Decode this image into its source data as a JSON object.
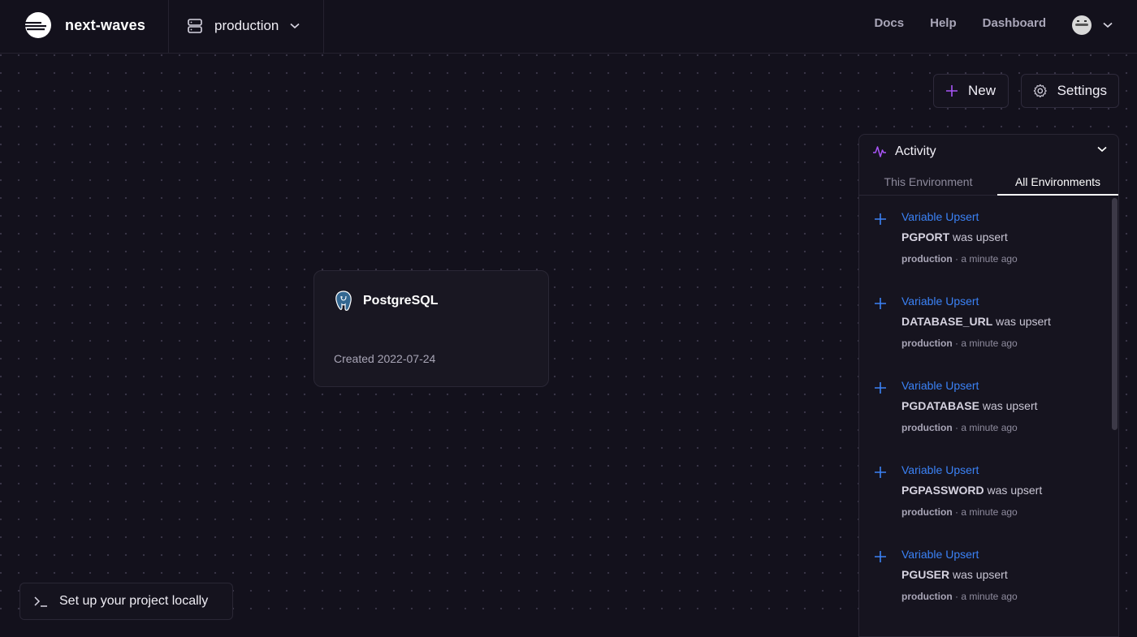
{
  "app": {
    "project_name": "next-waves",
    "environment": "production"
  },
  "nav": {
    "docs": "Docs",
    "help": "Help",
    "dashboard": "Dashboard"
  },
  "toolbar": {
    "new_label": "New",
    "settings_label": "Settings"
  },
  "service": {
    "name": "PostgreSQL",
    "created": "Created 2022-07-24",
    "icon": "postgresql-icon"
  },
  "setup": {
    "label": "Set up your project locally"
  },
  "activity": {
    "title": "Activity",
    "tabs": [
      "This Environment",
      "All Environments"
    ],
    "active_tab": "All Environments",
    "items": [
      {
        "title": "Variable Upsert",
        "variable": "PGPORT",
        "action": "was upsert",
        "env": "production",
        "time": "· a minute ago"
      },
      {
        "title": "Variable Upsert",
        "variable": "DATABASE_URL",
        "action": "was upsert",
        "env": "production",
        "time": "· a minute ago"
      },
      {
        "title": "Variable Upsert",
        "variable": "PGDATABASE",
        "action": "was upsert",
        "env": "production",
        "time": "· a minute ago"
      },
      {
        "title": "Variable Upsert",
        "variable": "PGPASSWORD",
        "action": "was upsert",
        "env": "production",
        "time": "· a minute ago"
      },
      {
        "title": "Variable Upsert",
        "variable": "PGUSER",
        "action": "was upsert",
        "env": "production",
        "time": "· a minute ago"
      }
    ]
  },
  "colors": {
    "background": "#13111c",
    "accent": "#3b82f6",
    "purple": "#a855f7"
  }
}
